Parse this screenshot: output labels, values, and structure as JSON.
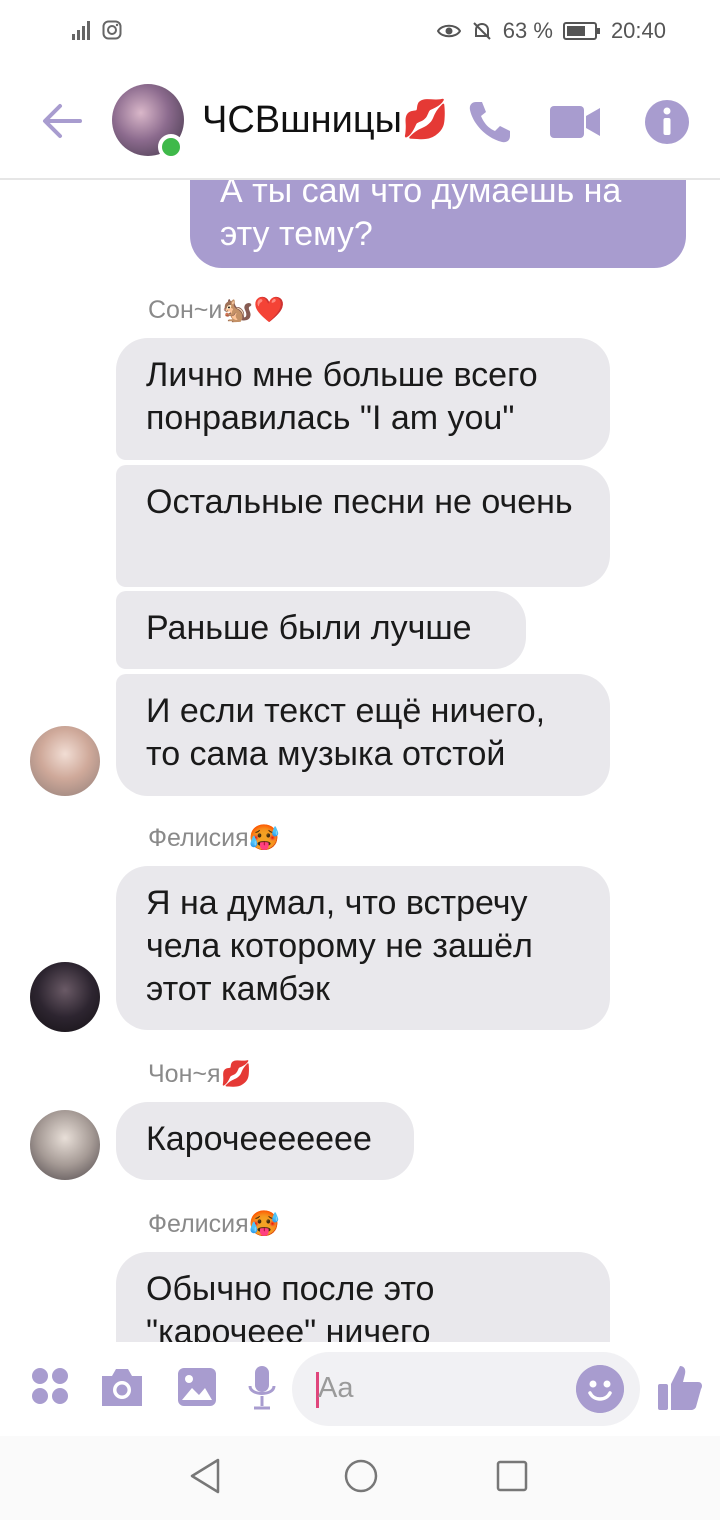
{
  "status_bar": {
    "battery_percent": "63 %",
    "time": "20:40"
  },
  "header": {
    "title": "ЧСВшницы💋",
    "online": true,
    "accent_color": "#a89ccf"
  },
  "messages": [
    {
      "type": "outgoing",
      "text": "А ты сам что думаешь на эту тему?"
    },
    {
      "type": "sender",
      "name": "Сон~и🐿️❤️"
    },
    {
      "type": "incoming",
      "text": "Лично мне больше всего понравилась \"I am you\""
    },
    {
      "type": "incoming",
      "text": "Остальные песни не очень"
    },
    {
      "type": "incoming",
      "text": "Раньше были лучше"
    },
    {
      "type": "incoming",
      "text": "И если текст ещё ничего, то сама музыка отстой"
    },
    {
      "type": "sender",
      "name": "Фелисия🥵"
    },
    {
      "type": "incoming",
      "text": "Я на думал, что встречу чела которому не зашёл этот камбэк"
    },
    {
      "type": "sender",
      "name": "Чон~я💋"
    },
    {
      "type": "incoming",
      "text": "Карочееееeee"
    },
    {
      "type": "sender",
      "name": "Фелисия🥵"
    },
    {
      "type": "incoming",
      "text": "Обычно после это \"карочеее\" ничего"
    }
  ],
  "input": {
    "placeholder": "Aa",
    "value": ""
  },
  "icons": {
    "header": [
      "back-arrow-icon",
      "phone-icon",
      "video-camera-icon",
      "info-icon"
    ],
    "input_bar": [
      "apps-icon",
      "camera-icon",
      "gallery-icon",
      "microphone-icon",
      "emoji-icon",
      "thumbs-up-icon"
    ],
    "nav": [
      "nav-back-icon",
      "nav-home-icon",
      "nav-recents-icon"
    ]
  }
}
